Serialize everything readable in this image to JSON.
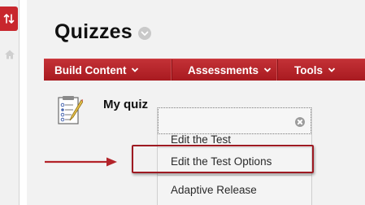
{
  "page": {
    "title": "Quizzes"
  },
  "action_bar": {
    "items": [
      {
        "label": "Build Content"
      },
      {
        "label": "Assessments"
      },
      {
        "label": "Tools"
      }
    ]
  },
  "content_item": {
    "title": "My quiz"
  },
  "context_menu": {
    "items": [
      {
        "label": "Edit the Test"
      },
      {
        "label": "Edit the Test Options"
      },
      {
        "label": "Adaptive Release"
      }
    ],
    "highlighted": "Edit the Test Options"
  },
  "colors": {
    "brand_red": "#b3242a",
    "rail_bg": "#f1f1f1",
    "content_bg": "#f2f2f2",
    "highlight_border": "#9e1a22"
  },
  "icons": {
    "rail_top": "swap-arrows-icon",
    "rail_nav": "home-icon",
    "title_menu": "chevron-circle-icon",
    "item": "quiz-test-icon",
    "menu_close": "close-circle-icon",
    "annotation": "red-arrow-icon"
  }
}
